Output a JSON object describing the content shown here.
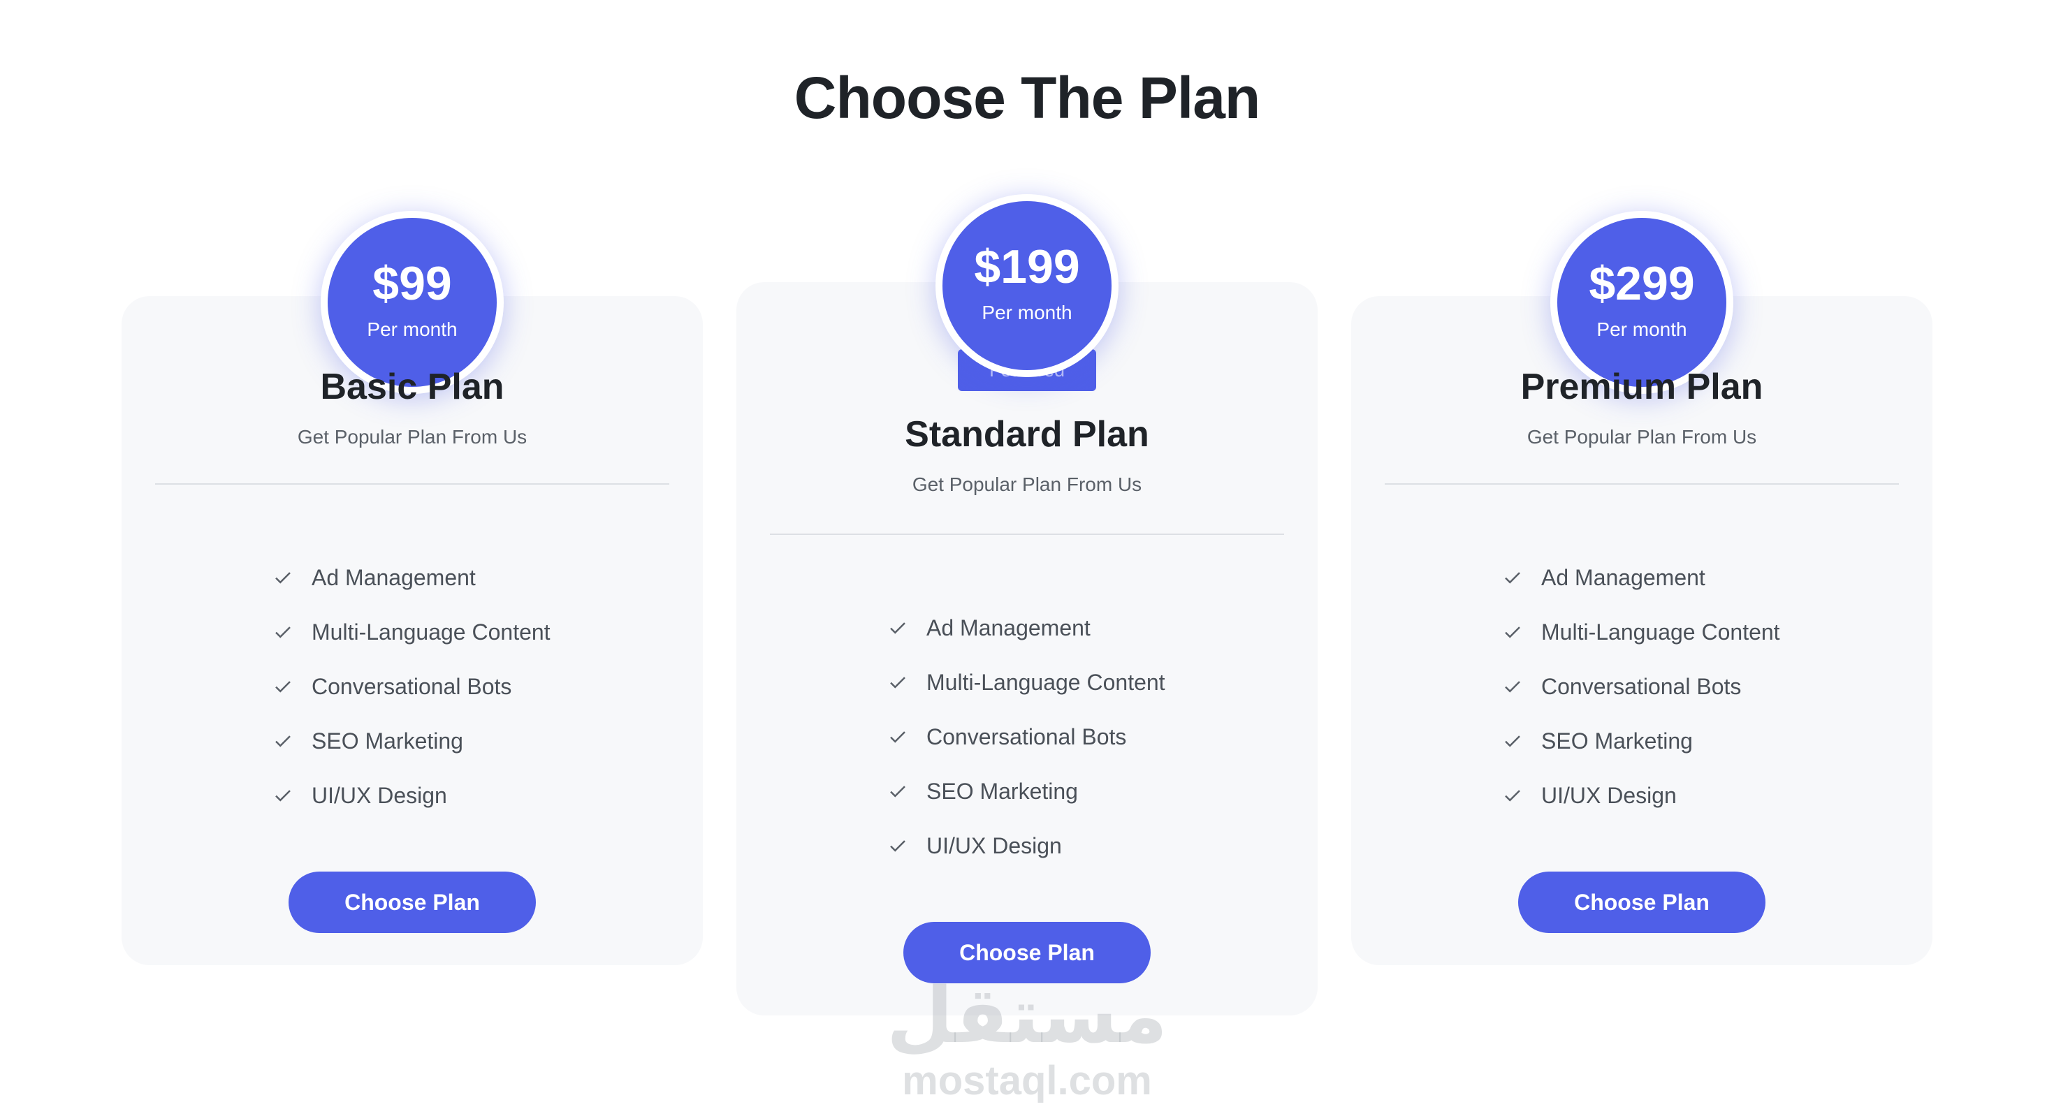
{
  "header": {
    "title": "Choose The Plan"
  },
  "plans": [
    {
      "price": "$99",
      "period": "Per month",
      "name": "Basic Plan",
      "subtitle": "Get Popular Plan From Us",
      "features": [
        "Ad Management",
        "Multi-Language Content",
        "Conversational Bots",
        "SEO Marketing",
        "UI/UX Design"
      ],
      "button": "Choose Plan"
    },
    {
      "price": "$199",
      "period": "Per month",
      "badge": "Featured",
      "name": "Standard Plan",
      "subtitle": "Get Popular Plan From Us",
      "features": [
        "Ad Management",
        "Multi-Language Content",
        "Conversational Bots",
        "SEO Marketing",
        "UI/UX Design"
      ],
      "button": "Choose Plan"
    },
    {
      "price": "$299",
      "period": "Per month",
      "name": "Premium Plan",
      "subtitle": "Get Popular Plan From Us",
      "features": [
        "Ad Management",
        "Multi-Language Content",
        "Conversational Bots",
        "SEO Marketing",
        "UI/UX Design"
      ],
      "button": "Choose Plan"
    }
  ],
  "icons": {
    "feature_bullet": "check-icon"
  },
  "colors": {
    "accent": "#4f5fe8",
    "card_bg": "#f7f8fa",
    "text_dark": "#1f2328"
  },
  "watermark": {
    "arabic": "مستقل",
    "latin": "mostaql.com"
  }
}
